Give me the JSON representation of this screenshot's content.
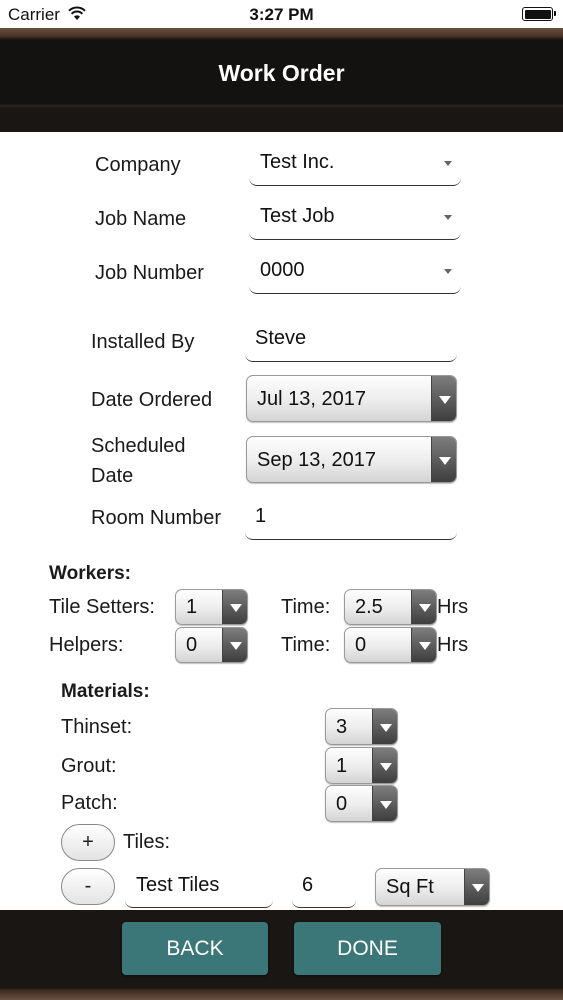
{
  "status": {
    "carrier": "Carrier",
    "time": "3:27 PM"
  },
  "nav": {
    "title": "Work Order"
  },
  "form": {
    "company_label": "Company",
    "company_value": "Test Inc.",
    "job_name_label": "Job Name",
    "job_name_value": "Test Job",
    "job_number_label": "Job Number",
    "job_number_value": "0000",
    "installed_by_label": "Installed By",
    "installed_by_value": "Steve",
    "date_ordered_label": "Date Ordered",
    "date_ordered_value": "Jul 13, 2017",
    "scheduled_label_line1": "Scheduled",
    "scheduled_label_line2": "Date",
    "scheduled_value": "Sep 13, 2017",
    "room_number_label": "Room Number",
    "room_number_value": "1"
  },
  "workers": {
    "heading": "Workers:",
    "tile_setters_label": "Tile Setters:",
    "tile_setters_value": "1",
    "tile_setters_time_label": "Time:",
    "tile_setters_time_value": "2.5",
    "tile_setters_unit": "Hrs",
    "helpers_label": "Helpers:",
    "helpers_value": "0",
    "helpers_time_label": "Time:",
    "helpers_time_value": "0",
    "helpers_unit": "Hrs"
  },
  "materials": {
    "heading": "Materials:",
    "thinset_label": "Thinset:",
    "thinset_value": "3",
    "grout_label": "Grout:",
    "grout_value": "1",
    "patch_label": "Patch:",
    "patch_value": "0",
    "tiles_label": "Tiles:",
    "add_label": "+",
    "remove_label": "-",
    "tile_name": "Test Tiles",
    "tile_qty": "6",
    "tile_unit": "Sq Ft"
  },
  "footer": {
    "back_label": "BACK",
    "done_label": "DONE"
  }
}
